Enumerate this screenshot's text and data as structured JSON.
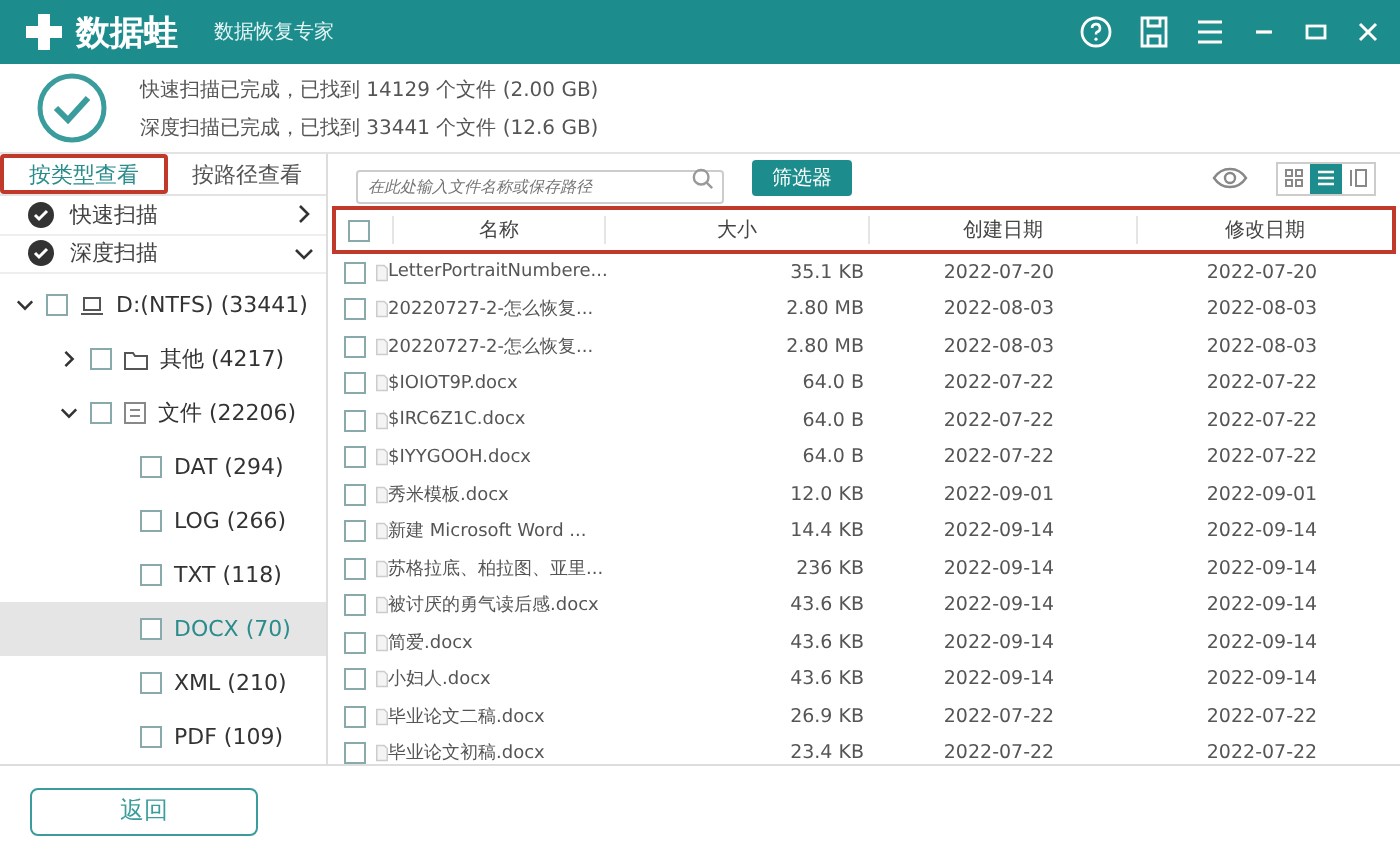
{
  "window": {
    "app_name": "数据蛙",
    "subtitle": "数据恢复专家"
  },
  "summary": {
    "lines": [
      "快速扫描已完成，已找到 14129 个文件 (2.00 GB)",
      "深度扫描已完成，已找到 33441 个文件 (12.6 GB)"
    ]
  },
  "view_tabs": [
    {
      "label": "按类型查看",
      "selected": true
    },
    {
      "label": "按路径查看",
      "selected": false
    }
  ],
  "search": {
    "placeholder": "在此处输入文件名称或保存路径"
  },
  "filter_button": "筛选器",
  "view_modes": [
    {
      "kind": "grid",
      "selected": false
    },
    {
      "kind": "list",
      "selected": true
    },
    {
      "kind": "panel",
      "selected": false
    }
  ],
  "scans": [
    {
      "label": "快速扫描",
      "expanded": false
    },
    {
      "label": "深度扫描",
      "expanded": true
    }
  ],
  "tree": [
    {
      "label": "D:(NTFS) (33441)",
      "kind": "drive",
      "expanded": true,
      "checked": false,
      "selected": false,
      "children": [
        {
          "label": "其他 (4217)",
          "kind": "folder",
          "expanded": false,
          "checked": false,
          "selected": false
        },
        {
          "label": "文件 (22206)",
          "kind": "doc",
          "expanded": true,
          "checked": false,
          "selected": false,
          "children": [
            {
              "label": "DAT (294)",
              "kind": "type",
              "checked": false,
              "selected": false
            },
            {
              "label": "LOG (266)",
              "kind": "type",
              "checked": false,
              "selected": false
            },
            {
              "label": "TXT (118)",
              "kind": "type",
              "checked": false,
              "selected": false
            },
            {
              "label": "DOCX (70)",
              "kind": "type",
              "checked": false,
              "selected": true
            },
            {
              "label": "XML (210)",
              "kind": "type",
              "checked": false,
              "selected": false
            },
            {
              "label": "PDF (109)",
              "kind": "type",
              "checked": false,
              "selected": false
            }
          ]
        }
      ]
    }
  ],
  "table": {
    "select_all_checked": false,
    "columns": [
      "名称",
      "大小",
      "创建日期",
      "修改日期"
    ],
    "rows": [
      {
        "name": "LetterPortraitNumbere...",
        "size": "35.1 KB",
        "created": "2022-07-20",
        "modified": "2022-07-20",
        "checked": false
      },
      {
        "name": "20220727-2-怎么恢复...",
        "size": "2.80 MB",
        "created": "2022-08-03",
        "modified": "2022-08-03",
        "checked": false
      },
      {
        "name": "20220727-2-怎么恢复...",
        "size": "2.80 MB",
        "created": "2022-08-03",
        "modified": "2022-08-03",
        "checked": false
      },
      {
        "name": "$IOIOT9P.docx",
        "size": "64.0 B",
        "created": "2022-07-22",
        "modified": "2022-07-22",
        "checked": false
      },
      {
        "name": "$IRC6Z1C.docx",
        "size": "64.0 B",
        "created": "2022-07-22",
        "modified": "2022-07-22",
        "checked": false
      },
      {
        "name": "$IYYGOOH.docx",
        "size": "64.0 B",
        "created": "2022-07-22",
        "modified": "2022-07-22",
        "checked": false
      },
      {
        "name": "秀米模板.docx",
        "size": "12.0 KB",
        "created": "2022-09-01",
        "modified": "2022-09-01",
        "checked": false
      },
      {
        "name": "新建 Microsoft Word ...",
        "size": "14.4 KB",
        "created": "2022-09-14",
        "modified": "2022-09-14",
        "checked": false
      },
      {
        "name": "苏格拉底、柏拉图、亚里...",
        "size": "236 KB",
        "created": "2022-09-14",
        "modified": "2022-09-14",
        "checked": false
      },
      {
        "name": "被讨厌的勇气读后感.docx",
        "size": "43.6 KB",
        "created": "2022-09-14",
        "modified": "2022-09-14",
        "checked": false
      },
      {
        "name": "简爱.docx",
        "size": "43.6 KB",
        "created": "2022-09-14",
        "modified": "2022-09-14",
        "checked": false
      },
      {
        "name": "小妇人.docx",
        "size": "43.6 KB",
        "created": "2022-09-14",
        "modified": "2022-09-14",
        "checked": false
      },
      {
        "name": "毕业论文二稿.docx",
        "size": "26.9 KB",
        "created": "2022-07-22",
        "modified": "2022-07-22",
        "checked": false
      },
      {
        "name": "毕业论文初稿.docx",
        "size": "23.4 KB",
        "created": "2022-07-22",
        "modified": "2022-07-22",
        "checked": false
      }
    ]
  },
  "back_button": "返回"
}
